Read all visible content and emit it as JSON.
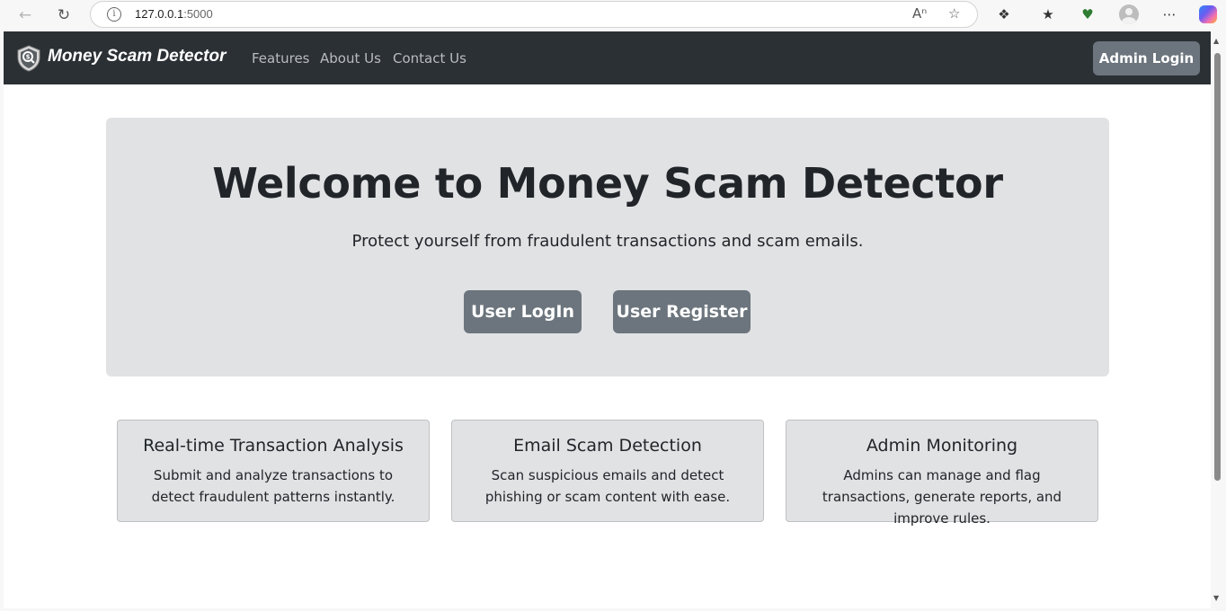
{
  "browser": {
    "url_host": "127.0.0.1",
    "url_port": ":5000"
  },
  "navbar": {
    "brand": "Money Scam Detector",
    "links": [
      "Features",
      "About Us",
      "Contact Us"
    ],
    "admin_login": "Admin Login"
  },
  "hero": {
    "title": "Welcome to Money Scam Detector",
    "subtitle": "Protect yourself from fraudulent transactions and scam emails.",
    "login_button": "User LogIn",
    "register_button": "User Register"
  },
  "features": [
    {
      "title": "Real-time Transaction Analysis",
      "text": "Submit and analyze transactions to detect fraudulent patterns instantly."
    },
    {
      "title": "Email Scam Detection",
      "text": "Scan suspicious emails and detect phishing or scam content with ease."
    },
    {
      "title": "Admin Monitoring",
      "text": "Admins can manage and flag transactions, generate reports, and improve rules."
    }
  ],
  "colors": {
    "navbar_bg": "#2b3035",
    "hero_bg": "#e1e2e4",
    "button_bg": "#6c757d"
  }
}
